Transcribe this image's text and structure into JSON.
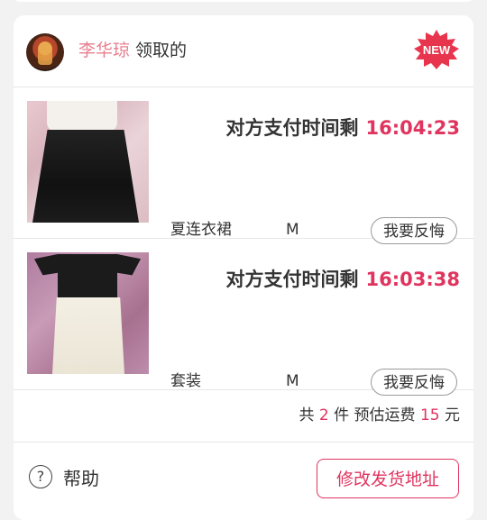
{
  "header": {
    "user_name": "李华琼",
    "user_suffix": "领取的",
    "badge_text": "NEW"
  },
  "items": [
    {
      "pay_label": "对方支付时间剩",
      "pay_time": "16:04:23",
      "name": "夏连衣裙",
      "size": "M",
      "regret_label": "我要反悔"
    },
    {
      "pay_label": "对方支付时间剩",
      "pay_time": "16:03:38",
      "name": "套装",
      "size": "M",
      "regret_label": "我要反悔"
    }
  ],
  "summary": {
    "prefix": "共",
    "count": "2",
    "count_unit": "件",
    "shipping_label": "预估运费",
    "shipping_amount": "15",
    "currency_unit": "元"
  },
  "footer": {
    "help_icon": "?",
    "help_label": "帮助",
    "address_button": "修改发货地址"
  },
  "colors": {
    "accent": "#e0345f",
    "user_name": "#e8808f",
    "badge": "#e8354e"
  }
}
